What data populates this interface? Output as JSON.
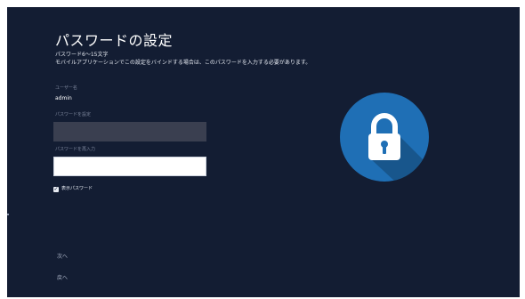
{
  "page": {
    "title": "パスワードの設定",
    "subtitle": "パスワード6～15文字",
    "description": "モバイルアプリケーションでこの設定をバインドする場合は、このパスワードを入力する必要があります。"
  },
  "user": {
    "label": "ユーザー名",
    "value": "admin"
  },
  "password": {
    "label": "パスワードを設定",
    "value": ""
  },
  "confirm": {
    "label": "パスワードを再入力",
    "value": ""
  },
  "show_password": {
    "label": "表示パスワード",
    "checked": true
  },
  "nav": {
    "next_label": "次へ",
    "back_label": "戻へ"
  },
  "icons": {
    "lock": "lock-icon",
    "check": "check-icon"
  },
  "colors": {
    "background": "#131d33",
    "lock_circle": "#1f6fb5",
    "lock_shadow": "#18568c",
    "accent_white": "#ffffff"
  }
}
